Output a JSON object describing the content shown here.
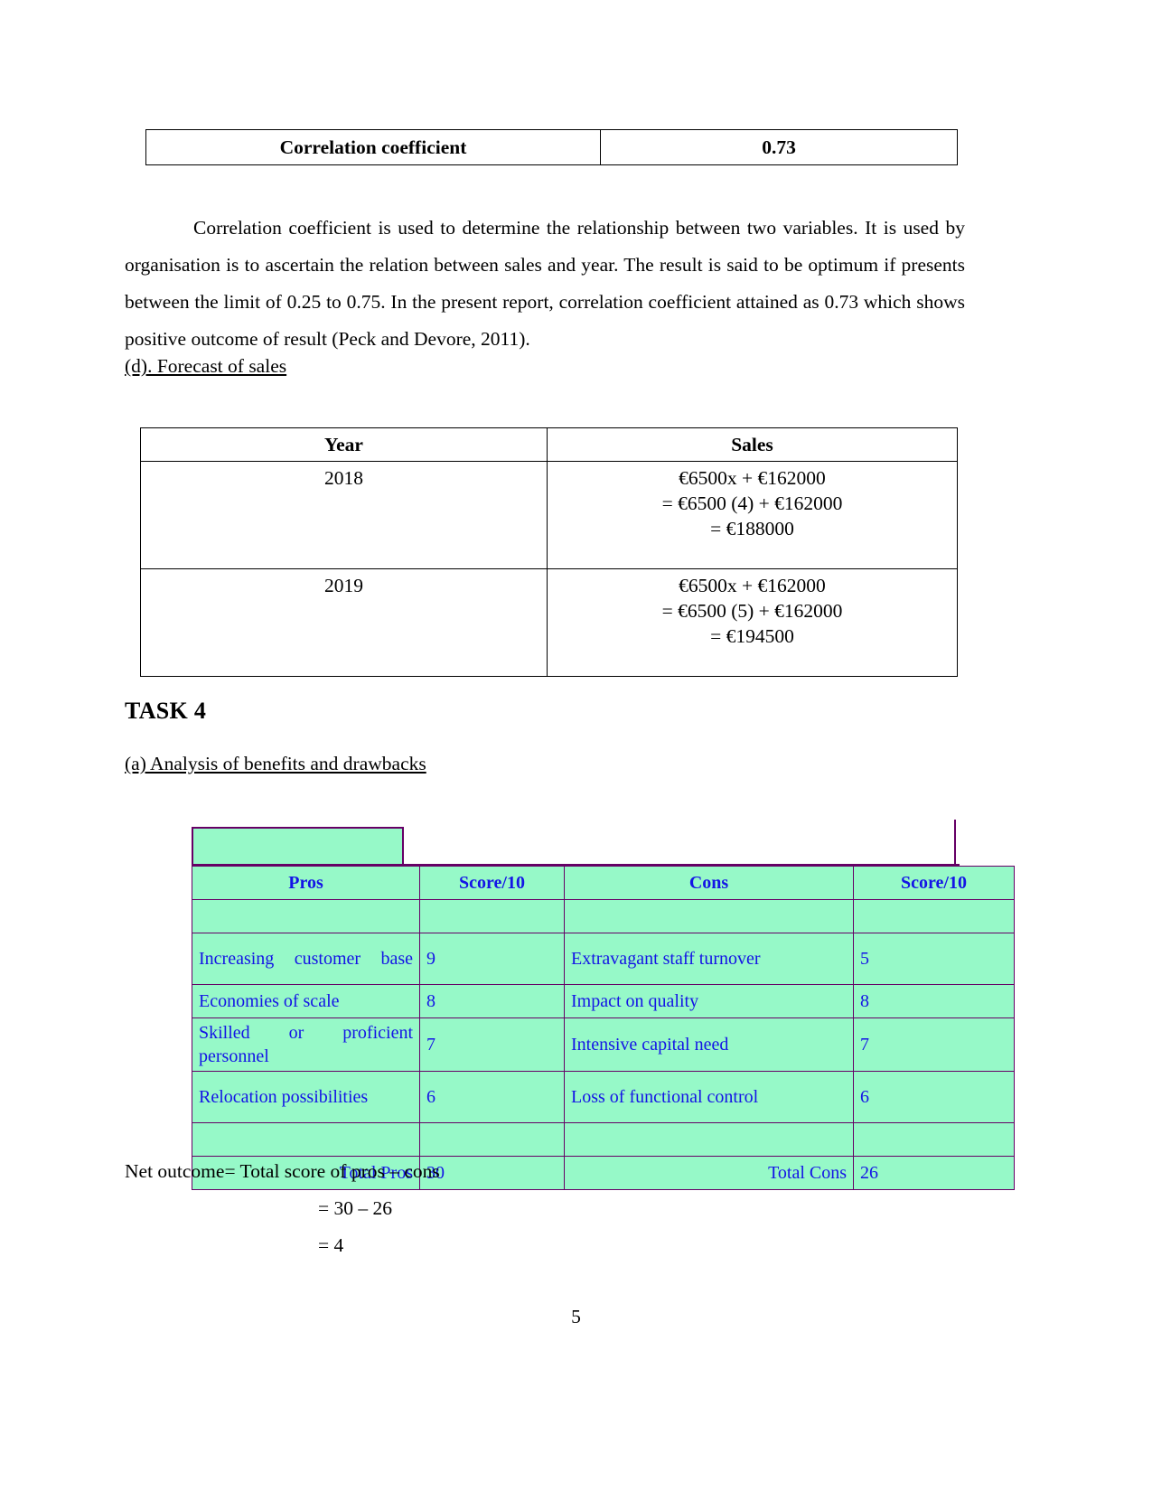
{
  "correlation_table": {
    "label": "Correlation coefficient",
    "value": "0.73"
  },
  "paragraph": "Correlation coefficient is used to determine the relationship between two variables. It is used by organisation is to ascertain the relation between sales and year. The result is said to be optimum if presents between the limit of 0.25 to 0.75. In the present report, correlation coefficient attained as 0.73 which shows positive outcome of result (Peck and Devore,  2011).",
  "headings": {
    "forecast": "(d). Forecast of sales",
    "task4": "TASK 4",
    "analysis": "(a) Analysis of benefits and drawbacks"
  },
  "sales_table": {
    "headers": [
      "Year",
      "Sales"
    ],
    "rows": [
      {
        "year": "2018",
        "sales_lines": [
          "€6500x + €162000",
          "= €6500 (4) + €162000",
          "= €188000"
        ]
      },
      {
        "year": "2019",
        "sales_lines": [
          "€6500x + €162000",
          "= €6500 (5) + €162000",
          "= €194500"
        ]
      }
    ]
  },
  "pros_cons_table": {
    "headers": [
      "Pros",
      "Score/10",
      "Cons",
      "Score/10"
    ],
    "rows": [
      {
        "pro": "Increasing customer base",
        "pro_score": "9",
        "con": "Extravagant staff turnover",
        "con_score": "5"
      },
      {
        "pro": "Economies of scale",
        "pro_score": "8",
        "con": "Impact on quality",
        "con_score": "8"
      },
      {
        "pro": "Skilled or proficient personnel",
        "pro_score": "7",
        "con": "Intensive capital need",
        "con_score": "7"
      },
      {
        "pro": "Relocation possibilities",
        "pro_score": "6",
        "con": "Loss of functional control",
        "con_score": "6"
      }
    ],
    "totals": {
      "pros_label": "Total Pros",
      "pros_value": "30",
      "cons_label": "Total Cons",
      "cons_value": "26"
    },
    "colors": {
      "cell_fill": "#96F9C8",
      "border": "#660066",
      "text": "#1414E6"
    }
  },
  "net_outcome": {
    "line1": "Net outcome= Total score of pros – cons",
    "line2": "= 30 – 26",
    "line3": "= 4"
  },
  "page_number": "5"
}
